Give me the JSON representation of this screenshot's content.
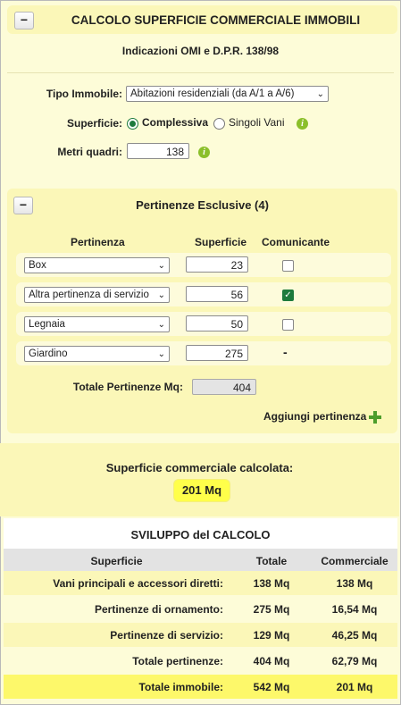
{
  "header": {
    "title": "CALCOLO SUPERFICIE COMMERCIALE IMMOBILI",
    "collapse_label": "−"
  },
  "subtitle": "Indicazioni OMI e D.P.R. 138/98",
  "form": {
    "tipo_label": "Tipo Immobile:",
    "tipo_value": "Abitazioni residenziali (da A/1 a A/6)",
    "superficie_label": "Superficie:",
    "radio_complessiva": "Complessiva",
    "radio_singoli": "Singoli Vani",
    "metri_label": "Metri quadri:",
    "metri_value": "138"
  },
  "pertinenze": {
    "collapse_label": "−",
    "title": "Pertinenze Esclusive (4)",
    "col_pertinenza": "Pertinenza",
    "col_superficie": "Superficie",
    "col_comunicante": "Comunicante",
    "rows": [
      {
        "type": "Box",
        "area": "23",
        "comunicante": "unchecked"
      },
      {
        "type": "Altra pertinenza di servizio",
        "area": "56",
        "comunicante": "checked"
      },
      {
        "type": "Legnaia",
        "area": "50",
        "comunicante": "unchecked"
      },
      {
        "type": "Giardino",
        "area": "275",
        "comunicante": "-"
      }
    ],
    "totale_label": "Totale Pertinenze Mq:",
    "totale_value": "404",
    "add_label": "Aggiungi pertinenza"
  },
  "result": {
    "title": "Superficie commerciale calcolata:",
    "value": "201 Mq"
  },
  "sviluppo": {
    "title": "SVILUPPO del CALCOLO",
    "headers": [
      "Superficie",
      "Totale",
      "Commerciale"
    ],
    "rows": [
      [
        "Vani principali e accessori diretti:",
        "138 Mq",
        "138 Mq"
      ],
      [
        "Pertinenze di ornamento:",
        "275 Mq",
        "16,54 Mq"
      ],
      [
        "Pertinenze di servizio:",
        "129 Mq",
        "46,25 Mq"
      ],
      [
        "Totale pertinenze:",
        "404 Mq",
        "62,79 Mq"
      ],
      [
        "Totale immobile:",
        "542 Mq",
        "201 Mq"
      ]
    ]
  },
  "colors": {
    "background": "#fdfcd8",
    "panel": "#fbf7b8",
    "highlight": "#ffff4a",
    "accent_green": "#1d7a3d",
    "info_icon": "#8bbf2a"
  }
}
